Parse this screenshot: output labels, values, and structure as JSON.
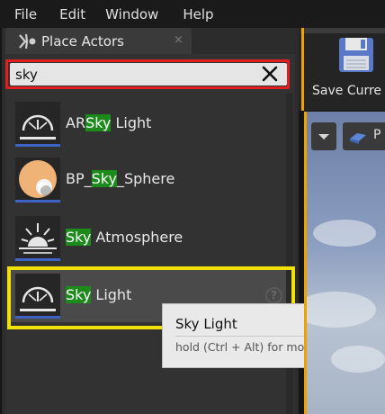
{
  "menu": {
    "file": "File",
    "edit": "Edit",
    "window": "Window",
    "help": "Help"
  },
  "panel": {
    "tab_title": "Place Actors",
    "tab_close": "×"
  },
  "search": {
    "value": "sky",
    "clear_icon": "close-x-icon"
  },
  "items": [
    {
      "pre": "AR",
      "hl": "Sky",
      "post": " Light",
      "icon": "sky-light-icon"
    },
    {
      "pre": "BP_",
      "hl": "Sky",
      "post": "_Sphere",
      "icon": "sky-sphere-icon"
    },
    {
      "pre": "",
      "hl": "Sky",
      "post": " Atmosphere",
      "icon": "sky-atmosphere-icon"
    },
    {
      "pre": "",
      "hl": "Sky",
      "post": " Light",
      "icon": "sky-light-icon",
      "selected": true
    }
  ],
  "help_icon": "?",
  "tooltip": {
    "title": "Sky Light",
    "hint": "hold (Ctrl + Alt) for more"
  },
  "toolbar": {
    "save_label": "Save Curre",
    "save_icon": "floppy-disk-icon"
  },
  "viewport": {
    "perspective_label": "P"
  },
  "colors": {
    "highlight": "#1c8b1c",
    "search_outline": "#e02020",
    "selection_outline": "#f0e10a",
    "accent": "#f0a000"
  }
}
